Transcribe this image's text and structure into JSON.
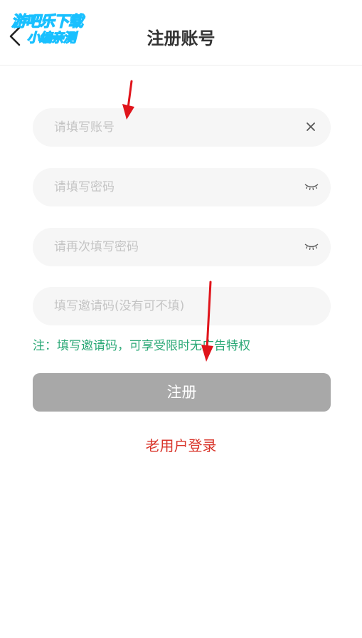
{
  "header": {
    "title": "注册账号",
    "watermark_line1": "游吧乐下载",
    "watermark_line2": "小编亲测"
  },
  "form": {
    "account_placeholder": "请填写账号",
    "password_placeholder": "请填写密码",
    "confirm_password_placeholder": "请再次填写密码",
    "invite_placeholder": "填写邀请码(没有可不填)",
    "note": "注：填写邀请码，可享受限时无广告特权",
    "register_label": "注册"
  },
  "footer": {
    "login_link": "老用户登录"
  },
  "icons": {
    "back": "chevron-left-icon",
    "clear": "close-icon",
    "eye": "eye-closed-icon",
    "annotation": "arrow-icon"
  },
  "colors": {
    "note": "#2aa876",
    "link": "#d9352b",
    "button": "#a8a8a8",
    "annotation_arrow": "#e0141b",
    "watermark": "#19c0ff"
  }
}
